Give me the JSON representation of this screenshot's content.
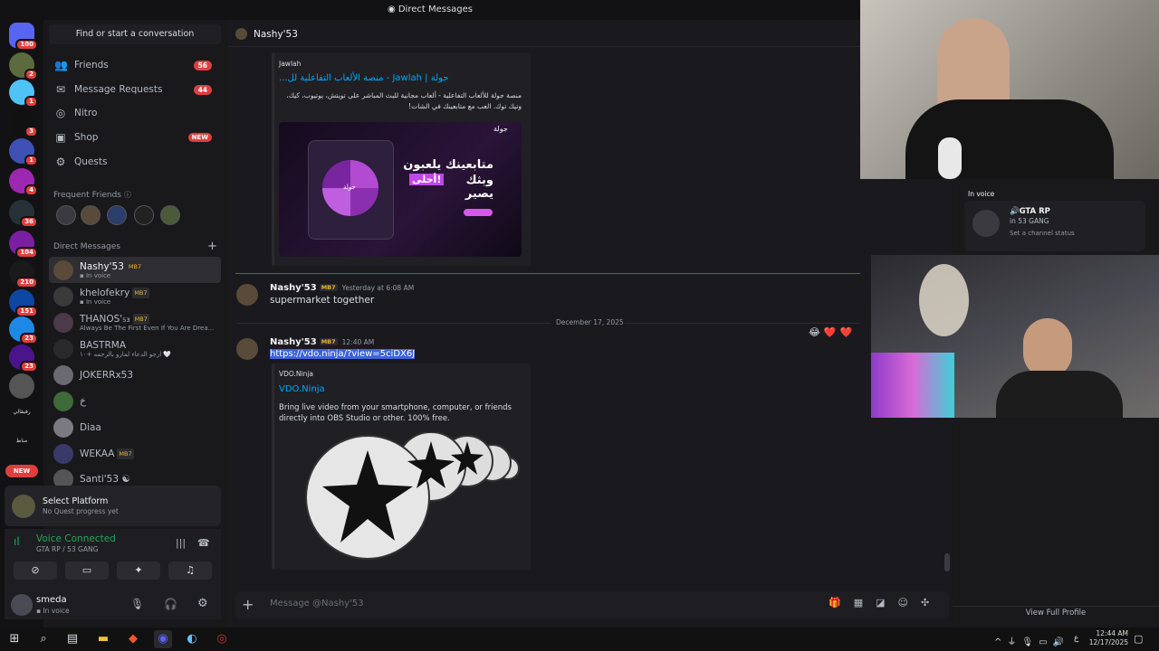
{
  "window_title": "Direct Messages",
  "rail": {
    "servers": [
      {
        "name": "discord-home",
        "badge": "100",
        "color": "#5865f2"
      },
      {
        "name": "server-1",
        "badge": "2",
        "color": "#5b6b3d"
      },
      {
        "name": "server-2",
        "badge": "1",
        "color": "#4fc3f7"
      },
      {
        "name": "server-3",
        "badge": "3",
        "color": "#111111"
      },
      {
        "name": "server-4",
        "badge": "1",
        "color": "#3f51b5"
      },
      {
        "name": "server-5",
        "badge": "4",
        "color": "#9c27b0"
      },
      {
        "name": "server-6",
        "badge": "36",
        "color": "#263238"
      },
      {
        "name": "server-7",
        "badge": "104",
        "color": "#7b1fa2"
      },
      {
        "name": "server-8",
        "badge": "210",
        "color": "#1a1a1a"
      },
      {
        "name": "server-9",
        "badge": "151",
        "color": "#0d47a1"
      },
      {
        "name": "server-10",
        "badge": "23",
        "color": "#1e88e5"
      },
      {
        "name": "server-11",
        "badge": "23",
        "color": "#4a148c"
      },
      {
        "name": "server-12",
        "badge": "",
        "color": "#555555"
      }
    ],
    "text_labels": [
      "رفيقالي",
      "مناظ"
    ],
    "new_label": "NEW"
  },
  "sidebar": {
    "search_label": "Find or start a conversation",
    "nav": [
      {
        "label": "Friends",
        "count": "56",
        "icon": "friends-icon"
      },
      {
        "label": "Message Requests",
        "count": "44",
        "icon": "mail-icon"
      },
      {
        "label": "Nitro",
        "count": "",
        "icon": "nitro-icon"
      },
      {
        "label": "Shop",
        "count": "",
        "icon": "shop-icon",
        "new": "NEW"
      },
      {
        "label": "Quests",
        "count": "",
        "icon": "quests-icon"
      }
    ],
    "frequent_friends_label": "Frequent Friends",
    "dm_header": "Direct Messages",
    "dms": [
      {
        "name": "Nashy'53",
        "tag": "MB7",
        "status": "In voice",
        "voice": true,
        "active": true
      },
      {
        "name": "khelofekry",
        "tag": "MB7",
        "status": "In voice",
        "voice": true
      },
      {
        "name": "THANOS'₅₃",
        "tag": "MB7",
        "status": "Always Be The First Even If You Are Drea..."
      },
      {
        "name": "BASTRMA",
        "tag": "",
        "status": "ارجو الدعاء لمارو بالرحمه +١٠ 🤍"
      },
      {
        "name": "JOKERRx53",
        "tag": "",
        "status": ""
      },
      {
        "name": "حَ",
        "tag": "",
        "status": ""
      },
      {
        "name": "Diaa",
        "tag": "",
        "status": ""
      },
      {
        "name": "WEKAA",
        "tag": "MB7",
        "status": ""
      },
      {
        "name": "Santi'53 ☯",
        "tag": "",
        "status": ""
      }
    ]
  },
  "quest_panel": {
    "title": "Select Platform",
    "subtitle": "No Quest progress yet"
  },
  "voice_panel": {
    "status": "Voice Connected",
    "channel": "GTA RP / 53 GANG"
  },
  "user_panel": {
    "name": "smeda",
    "status": "In voice"
  },
  "chat": {
    "header_name": "Nashy'53",
    "embed1": {
      "site": "Jawlah",
      "title": "جولة | Jawlah - منصة الألعاب التفاعلية لل...",
      "description": "منصة جولة للألعاب التفاعلية - ألعاب مجانية للبث المباشر على تويتش، يوتيوب، كيك، وتيك توك. العب مع متابعينك في الشات!",
      "image_brand": "جولة",
      "image_headline_1": "متابعينك يلعبون",
      "image_headline_2": "وبثك يصير",
      "image_highlight": "أحلى!",
      "image_wheel_center": "جولة"
    },
    "divider_new": "",
    "msg1": {
      "author": "Nashy'53",
      "tag": "MB7",
      "time": "Yesterday at 6:08 AM",
      "text": "supermarket together"
    },
    "date_divider": "December 17, 2025",
    "msg2": {
      "author": "Nashy'53",
      "tag": "MB7",
      "time": "12:40 AM",
      "link": "https://vdo.ninja/?view=5ciDX6J"
    },
    "embed2": {
      "site": "VDO.Ninja",
      "title": "VDO.Ninja",
      "description": "Bring live video from your smartphone, computer, or friends directly into OBS Studio or other. 100% free."
    },
    "reactions": [
      "😂",
      "❤️",
      "❤️"
    ],
    "input_placeholder": "Message @Nashy'53"
  },
  "profile": {
    "in_voice_label": "In voice",
    "channel": "GTA RP",
    "server": "in 53 GANG",
    "status_prompt": "Set a channel status",
    "view_full": "View Full Profile"
  },
  "taskbar": {
    "time": "12:44 AM",
    "date": "12/17/2025",
    "lang": "ع"
  }
}
